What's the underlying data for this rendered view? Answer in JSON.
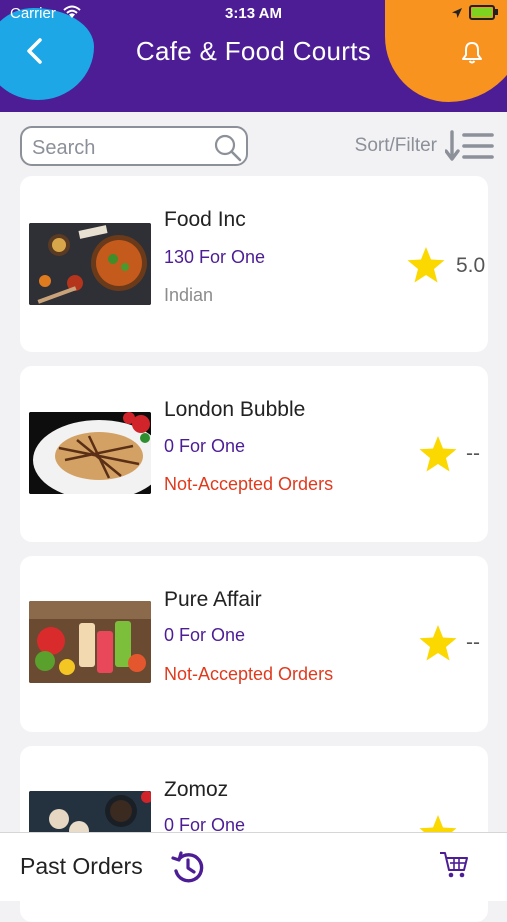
{
  "status_bar": {
    "carrier": "Carrier",
    "time": "3:13 AM"
  },
  "header": {
    "title": "Cafe & Food Courts",
    "back_icon": "chevron-left-icon",
    "bell_icon": "bell-icon"
  },
  "colors": {
    "header_bg": "#4c1d95",
    "accent_blue": "#1ea7e6",
    "accent_orange": "#f7931e",
    "star": "#fbd800",
    "warning": "#e03a1e",
    "offer": "#4c1d95"
  },
  "search": {
    "placeholder": "Search",
    "value": ""
  },
  "sort_filter": {
    "label": "Sort/Filter"
  },
  "restaurants": [
    {
      "name": "Food Inc",
      "offer": "130 For One",
      "subtitle": "Indian",
      "subtitle_type": "cuisine",
      "rating": "5.0"
    },
    {
      "name": "London Bubble",
      "offer": "0 For One",
      "subtitle": "Not-Accepted Orders",
      "subtitle_type": "warning",
      "rating": "--"
    },
    {
      "name": "Pure Affair",
      "offer": "0 For One",
      "subtitle": "Not-Accepted Orders",
      "subtitle_type": "warning",
      "rating": "--"
    },
    {
      "name": "Zomoz",
      "offer": "0 For One",
      "subtitle": "",
      "subtitle_type": "warning",
      "rating": ""
    }
  ],
  "bottom_bar": {
    "past_orders_label": "Past Orders",
    "history_icon": "history-icon",
    "cart_icon": "cart-icon"
  }
}
